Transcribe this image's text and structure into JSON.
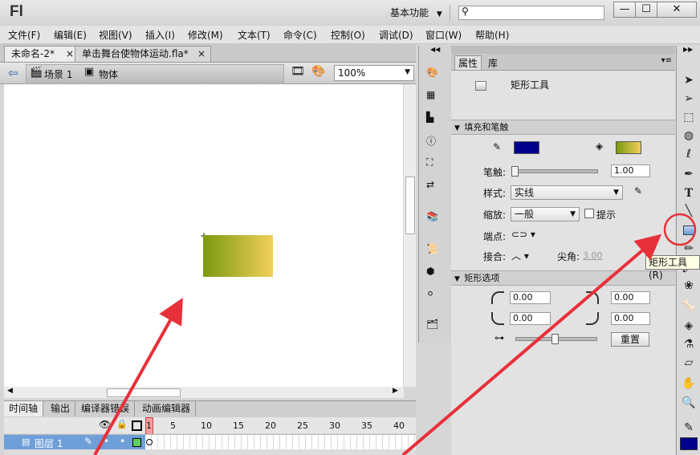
{
  "app": {
    "logo": "Fl",
    "workspace": "基本功能",
    "search_placeholder": ""
  },
  "window": {
    "minimize": "—",
    "maximize": "☐",
    "close": "✕"
  },
  "menu": [
    "文件(F)",
    "编辑(E)",
    "视图(V)",
    "插入(I)",
    "修改(M)",
    "文本(T)",
    "命令(C)",
    "控制(O)",
    "调试(D)",
    "窗口(W)",
    "帮助(H)"
  ],
  "doc_tabs": [
    {
      "label": "未命名-2*",
      "close": "×",
      "active": true
    },
    {
      "label": "单击舞台使物体运动.fla*",
      "close": "×",
      "active": false
    }
  ],
  "edit_bar": {
    "scene": "场景 1",
    "symbol": "物体",
    "zoom": "100%"
  },
  "timeline": {
    "tabs": [
      "时间轴",
      "输出",
      "编译器错误",
      "动画编辑器"
    ],
    "frame_numbers": [
      "1",
      "5",
      "10",
      "15",
      "20",
      "25",
      "30",
      "35",
      "40"
    ],
    "layer_name": "图层 1"
  },
  "properties": {
    "tabs": [
      "属性",
      "库"
    ],
    "tool_name": "矩形工具",
    "section_fill": "填充和笔触",
    "stroke_label": "笔触:",
    "stroke_value": "1.00",
    "style_label": "样式:",
    "style_value": "实线",
    "scale_label": "缩放:",
    "scale_value": "一般",
    "hint_label": "提示",
    "cap_label": "端点:",
    "join_label": "接合:",
    "miter_label": "尖角:",
    "miter_value": "3.00",
    "section_rect": "矩形选项",
    "corner_tl": "0.00",
    "corner_tr": "0.00",
    "corner_bl": "0.00",
    "corner_br": "0.00",
    "reset": "重置"
  },
  "tooltip": "矩形工具(R)",
  "colors": {
    "stroke_color": "#00008b",
    "fill_gradient_start": "#7a9a10",
    "fill_gradient_end": "#f2cf5a",
    "annotation": "#e8303a",
    "timeline_playhead": "#e05050"
  },
  "icons": {
    "tools": [
      "selection-arrow",
      "subselection-arrow",
      "free-transform",
      "3d-rotation",
      "lasso",
      "pen",
      "text",
      "line",
      "rectangle",
      "pencil",
      "brush",
      "deco",
      "bone",
      "paint-bucket",
      "eyedropper",
      "eraser",
      "hand",
      "zoom",
      "stroke-color",
      "fill-color"
    ]
  }
}
